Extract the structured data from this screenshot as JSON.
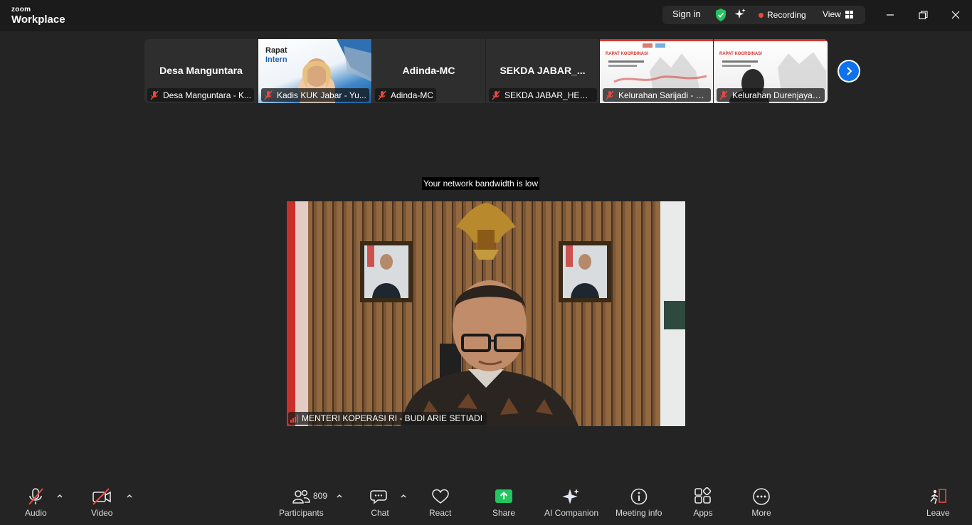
{
  "app": {
    "brand_top": "zoom",
    "brand_bottom": "Workplace"
  },
  "titlebar": {
    "sign_in": "Sign in",
    "recording": "Recording",
    "view": "View"
  },
  "colors": {
    "recording": "#e8493f",
    "shield": "#22c55e",
    "share": "#22c55e",
    "accent": "#0e72ed",
    "mute": "#e8493f"
  },
  "filmstrip": {
    "tiles": [
      {
        "bigname": "Desa  Manguntara",
        "label": "Desa Manguntara - K..."
      },
      {
        "label": "Kadis KUK Jabar - Yu..."
      },
      {
        "bigname": "Adinda-MC",
        "label": "Adinda-MC"
      },
      {
        "bigname": "SEKDA JABAR_...",
        "label": "SEKDA JABAR_HERM..."
      },
      {
        "label": "Kelurahan Sarijadi - S..."
      },
      {
        "label": "Kelurahan Durenjaya_..."
      }
    ],
    "thumb_text": {
      "rapat": "Rapat",
      "intern": "Intern",
      "koordinasi": "RAPAT KOORDINASI"
    }
  },
  "notice": "Your network bandwidth is low",
  "main_video": {
    "label": "MENTERI KOPERASI RI - BUDI ARIE SETIADI"
  },
  "toolbar": {
    "audio": "Audio",
    "video": "Video",
    "participants": "Participants",
    "participants_count": "809",
    "chat": "Chat",
    "react": "React",
    "share": "Share",
    "ai_companion": "AI Companion",
    "meeting_info": "Meeting info",
    "apps": "Apps",
    "more": "More",
    "leave": "Leave"
  }
}
